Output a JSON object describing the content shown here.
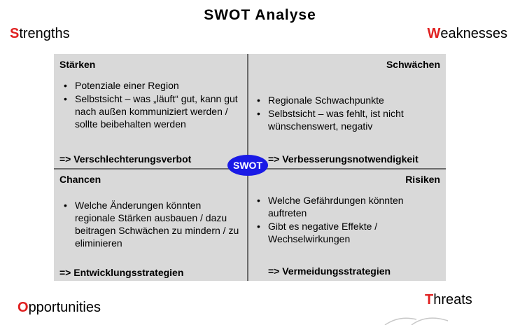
{
  "title": "SWOT Analyse",
  "corners": {
    "strengths": {
      "first": "S",
      "rest": "trengths"
    },
    "weaknesses": {
      "first": "W",
      "rest": "eaknesses"
    },
    "opportunities": {
      "first": "O",
      "rest": "pportunities"
    },
    "threats": {
      "first": "T",
      "rest": "hreats"
    }
  },
  "quadrants": {
    "staerken": {
      "heading": "Stärken",
      "items": [
        "Potenziale einer Region",
        "Selbstsicht – was „läuft“ gut, kann gut nach außen kommuniziert werden / sollte beibehalten werden"
      ],
      "footer": "=> Verschlechterungsverbot"
    },
    "schwaechen": {
      "heading": "Schwächen",
      "items": [
        "Regionale Schwachpunkte",
        "Selbstsicht – was fehlt, ist nicht wünschenswert, negativ"
      ],
      "footer": "=> Verbesserungsnotwendigkeit"
    },
    "chancen": {
      "heading": "Chancen",
      "items": [
        "Welche Änderungen könnten regionale Stärken ausbauen / dazu beitragen Schwächen zu mindern / zu eliminieren"
      ],
      "footer": "=> Entwicklungsstrategien"
    },
    "risiken": {
      "heading": "Risiken",
      "items": [
        "Welche Gefährdungen könnten auftreten",
        "Gibt es negative Effekte / Wechselwirkungen"
      ],
      "footer": "=> Vermeidungsstrategien"
    }
  },
  "center_badge": "SWOT",
  "colors": {
    "accent_red": "#e02020",
    "badge_blue": "#1a1ae6",
    "panel_gray": "#d9d9d9",
    "divider": "#6b6b6b"
  }
}
